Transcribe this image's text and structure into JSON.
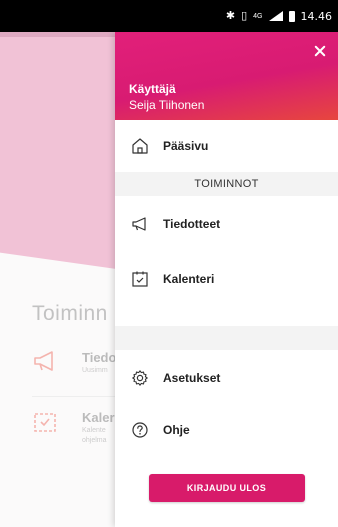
{
  "status_bar": {
    "time": "14.46",
    "network": "4G",
    "icons": [
      "bluetooth-icon",
      "vibrate-icon",
      "signal-icon",
      "battery-icon"
    ]
  },
  "background": {
    "section_title": "Toiminn",
    "items": [
      {
        "name": "Tiedo",
        "desc": "Uusimm",
        "icon": "megaphone-icon"
      },
      {
        "name": "Kaler",
        "desc": "Kalente ohjelma",
        "icon": "calendar-icon"
      }
    ]
  },
  "drawer": {
    "user_label": "Käyttäjä",
    "user_name": "Seija Tiihonen",
    "home_label": "Pääsivu",
    "section_header": "TOIMINNOT",
    "items": [
      {
        "label": "Tiedotteet",
        "icon": "megaphone-icon"
      },
      {
        "label": "Kalenteri",
        "icon": "calendar-icon"
      }
    ],
    "settings_label": "Asetukset",
    "help_label": "Ohje",
    "logout_label": "KIRJAUDU ULOS"
  },
  "colors": {
    "accent": "#d81b6a",
    "header_start": "#e2207a",
    "header_end": "#e7463e",
    "hero_bg": "#efb8cf"
  }
}
